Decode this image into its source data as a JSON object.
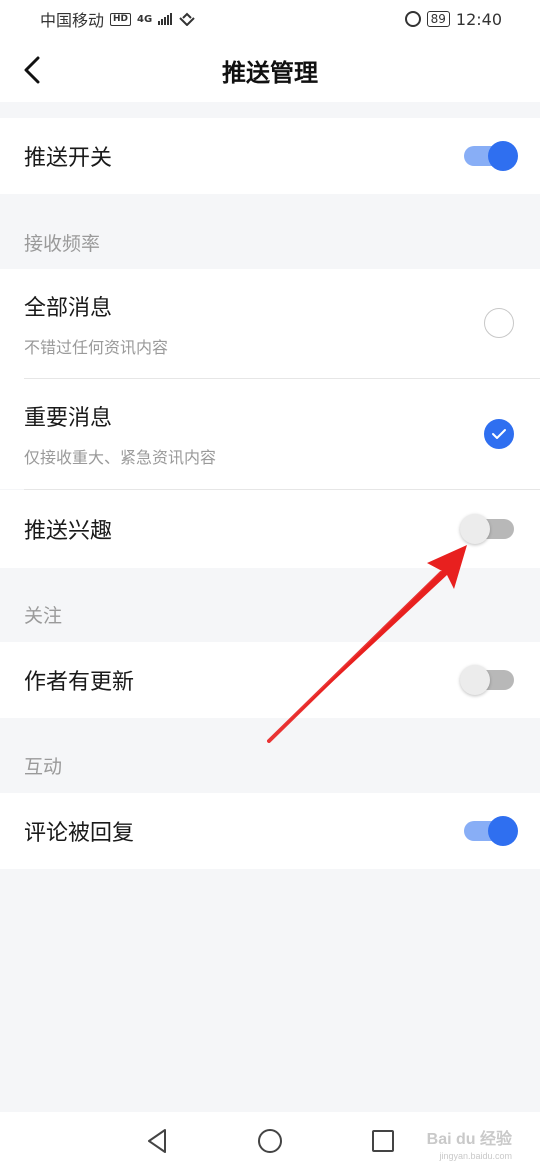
{
  "status_bar": {
    "carrier": "中国移动",
    "hd": "HD",
    "network": "4G",
    "battery": "89",
    "time": "12:40"
  },
  "nav": {
    "title": "推送管理"
  },
  "push_switch": {
    "label": "推送开关",
    "on": true
  },
  "frequency": {
    "header": "接收频率",
    "options": [
      {
        "label": "全部消息",
        "sub": "不错过任何资讯内容",
        "checked": false
      },
      {
        "label": "重要消息",
        "sub": "仅接收重大、紧急资讯内容",
        "checked": true
      }
    ]
  },
  "push_interest": {
    "label": "推送兴趣",
    "on": false
  },
  "follow": {
    "header": "关注",
    "author_update": {
      "label": "作者有更新",
      "on": false
    }
  },
  "interaction": {
    "header": "互动",
    "comment_reply": {
      "label": "评论被回复",
      "on": true
    }
  },
  "watermark": {
    "text": "Bai du 经验",
    "sub": "jingyan.baidu.com"
  },
  "colors": {
    "accent": "#2f6ff0",
    "annotation_arrow": "#e8201f"
  }
}
